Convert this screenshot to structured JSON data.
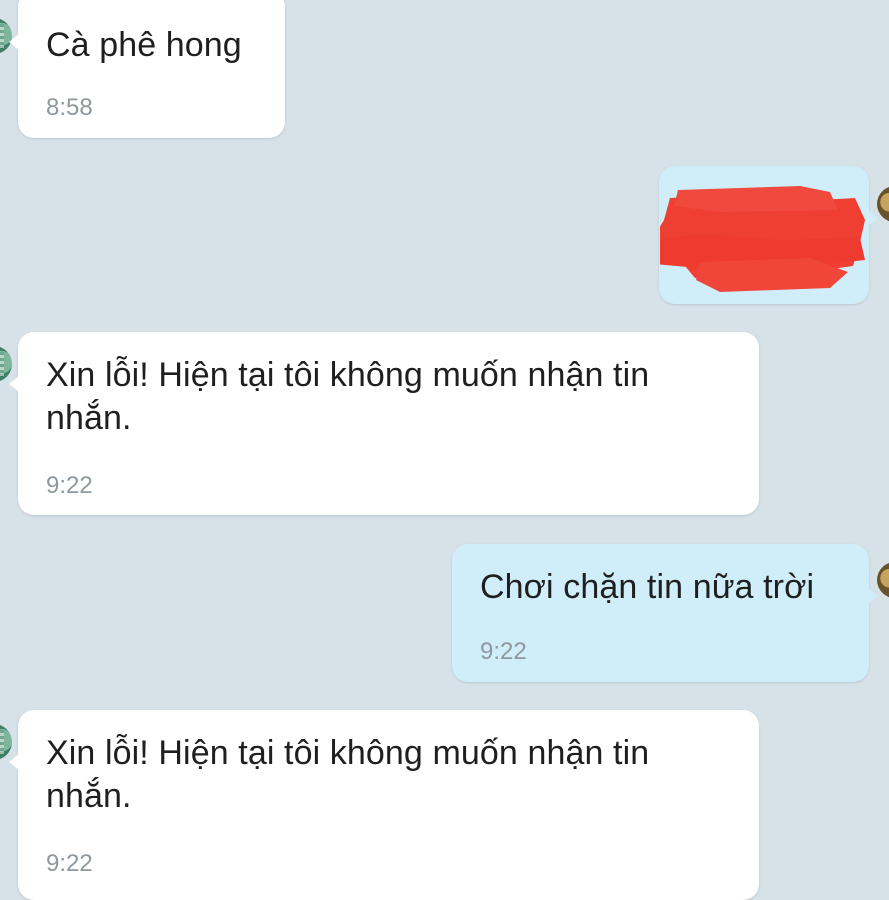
{
  "conversation": {
    "messages": [
      {
        "direction": "incoming",
        "text": "Cà phê hong",
        "time": "8:58"
      },
      {
        "direction": "outgoing",
        "text": "",
        "time": "",
        "redacted": true
      },
      {
        "direction": "incoming",
        "text": "Xin lỗi! Hiện tại tôi không muốn nhận tin nhắn.",
        "time": "9:22"
      },
      {
        "direction": "outgoing",
        "text": "Chơi chặn tin nữa trời",
        "time": "9:22"
      },
      {
        "direction": "incoming",
        "text": "Xin lỗi! Hiện tại tôi không muốn nhận tin nhắn.",
        "time": "9:22"
      }
    ]
  },
  "colors": {
    "background": "#d6e1e8",
    "incoming_bubble": "#ffffff",
    "outgoing_bubble": "#cfeef9",
    "timestamp": "#8f989e",
    "redaction": "#ef3f33"
  },
  "icons": {
    "contact_avatar": "contact-avatar-icon",
    "my_avatar": "my-avatar-icon"
  }
}
